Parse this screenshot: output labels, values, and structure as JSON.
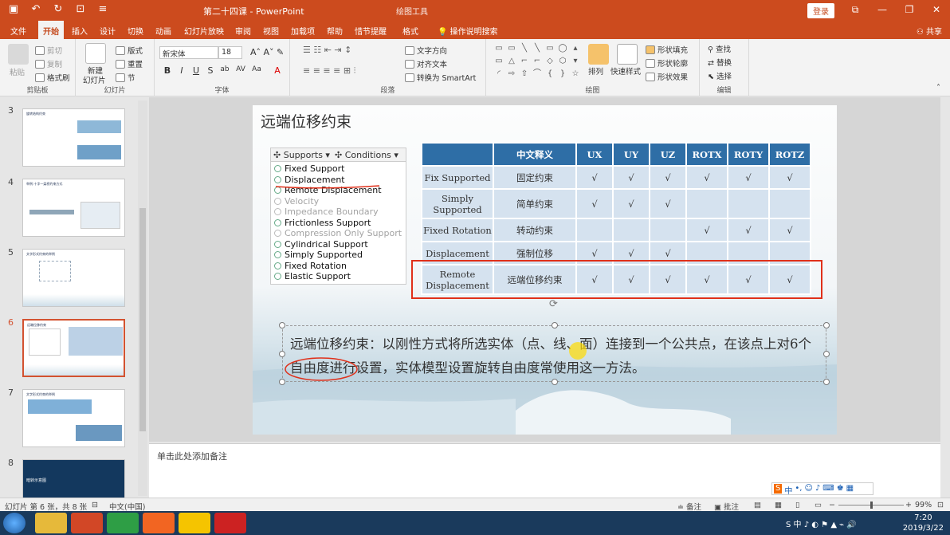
{
  "titlebar": {
    "doc_title": "第二十四课 - PowerPoint",
    "context_title": "绘图工具",
    "login": "登录"
  },
  "tabs": [
    "文件",
    "开始",
    "插入",
    "设计",
    "切换",
    "动画",
    "幻灯片放映",
    "审阅",
    "视图",
    "加载项",
    "帮助",
    "惜节提醒",
    "格式"
  ],
  "active_tab": "开始",
  "tell_me": "操作说明搜索",
  "share": "共享",
  "ribbon": {
    "clipboard": {
      "paste": "粘贴",
      "cut": "剪切",
      "copy": "复制",
      "format_painter": "格式刷",
      "label": "剪贴板"
    },
    "slides": {
      "new_slide": "新建",
      "new_slide2": "幻灯片",
      "layout": "版式",
      "reset": "重置",
      "section": "节",
      "label": "幻灯片"
    },
    "font": {
      "name": "新宋体",
      "size": "18",
      "label": "字体"
    },
    "paragraph": {
      "text_direction": "文字方向",
      "align_text": "对齐文本",
      "smartart": "转换为 SmartArt",
      "label": "段落"
    },
    "drawing": {
      "arrange": "排列",
      "quick_styles": "快速样式",
      "shape_fill": "形状填充",
      "shape_outline": "形状轮廓",
      "shape_effects": "形状效果",
      "label": "绘图"
    },
    "editing": {
      "find": "查找",
      "replace": "替换",
      "select": "选择",
      "label": "编辑"
    }
  },
  "thumbnails": [
    {
      "num": "3",
      "title": "旋转结构约束"
    },
    {
      "num": "4",
      "title": "举例:十字一梁桥约束方式"
    },
    {
      "num": "5",
      "title": "文字形式约束的举例"
    },
    {
      "num": "6",
      "title": "远端位移约束"
    },
    {
      "num": "7",
      "title": "文字形式约束的举例"
    },
    {
      "num": "8",
      "title": "暗转示意图"
    }
  ],
  "slide": {
    "title": "远端位移约束",
    "menu": {
      "bar": [
        "Supports",
        "Conditions"
      ],
      "items": [
        {
          "label": "Fixed Support",
          "dim": false
        },
        {
          "label": "Displacement",
          "dim": false
        },
        {
          "label": "Remote Displacement",
          "dim": false
        },
        {
          "label": "Velocity",
          "dim": true
        },
        {
          "label": "Impedance Boundary",
          "dim": true
        },
        {
          "label": "Frictionless Support",
          "dim": false
        },
        {
          "label": "Compression Only Support",
          "dim": true
        },
        {
          "label": "Cylindrical Support",
          "dim": false
        },
        {
          "label": "Simply Supported",
          "dim": false
        },
        {
          "label": "Fixed Rotation",
          "dim": false
        },
        {
          "label": "Elastic Support",
          "dim": false
        }
      ]
    },
    "table": {
      "headers": [
        "",
        "中文释义",
        "UX",
        "UY",
        "UZ",
        "ROTX",
        "ROTY",
        "ROTZ"
      ],
      "rows": [
        [
          "Fix Supported",
          "固定约束",
          "√",
          "√",
          "√",
          "√",
          "√",
          "√"
        ],
        [
          "Simply Supported",
          "简单约束",
          "√",
          "√",
          "√",
          "",
          "",
          ""
        ],
        [
          "Fixed Rotation",
          "转动约束",
          "",
          "",
          "",
          "√",
          "√",
          "√"
        ],
        [
          "Displacement",
          "强制位移",
          "√",
          "√",
          "√",
          "",
          "",
          ""
        ],
        [
          "Remote Displacement",
          "远端位移约束",
          "√",
          "√",
          "√",
          "√",
          "√",
          "√"
        ]
      ]
    },
    "body": "远端位移约束：以刚性方式将所选实体（点、线、面）连接到一个公共点，在该点上对6个自由度进行设置，实体模型设置旋转自由度常使用这一方法。"
  },
  "notes_placeholder": "单击此处添加备注",
  "status": {
    "slide_info": "幻灯片 第 6 张，共 8 张",
    "language": "中文(中国)",
    "notes": "备注",
    "comments": "批注",
    "zoom": "99%"
  },
  "taskbar": {
    "time": "7:20",
    "date": "2019/3/22"
  },
  "colors": {
    "accent": "#cc4b1e",
    "table_header": "#2e6ea6",
    "table_cell": "#d5e2ef",
    "highlight": "#e0301a"
  }
}
